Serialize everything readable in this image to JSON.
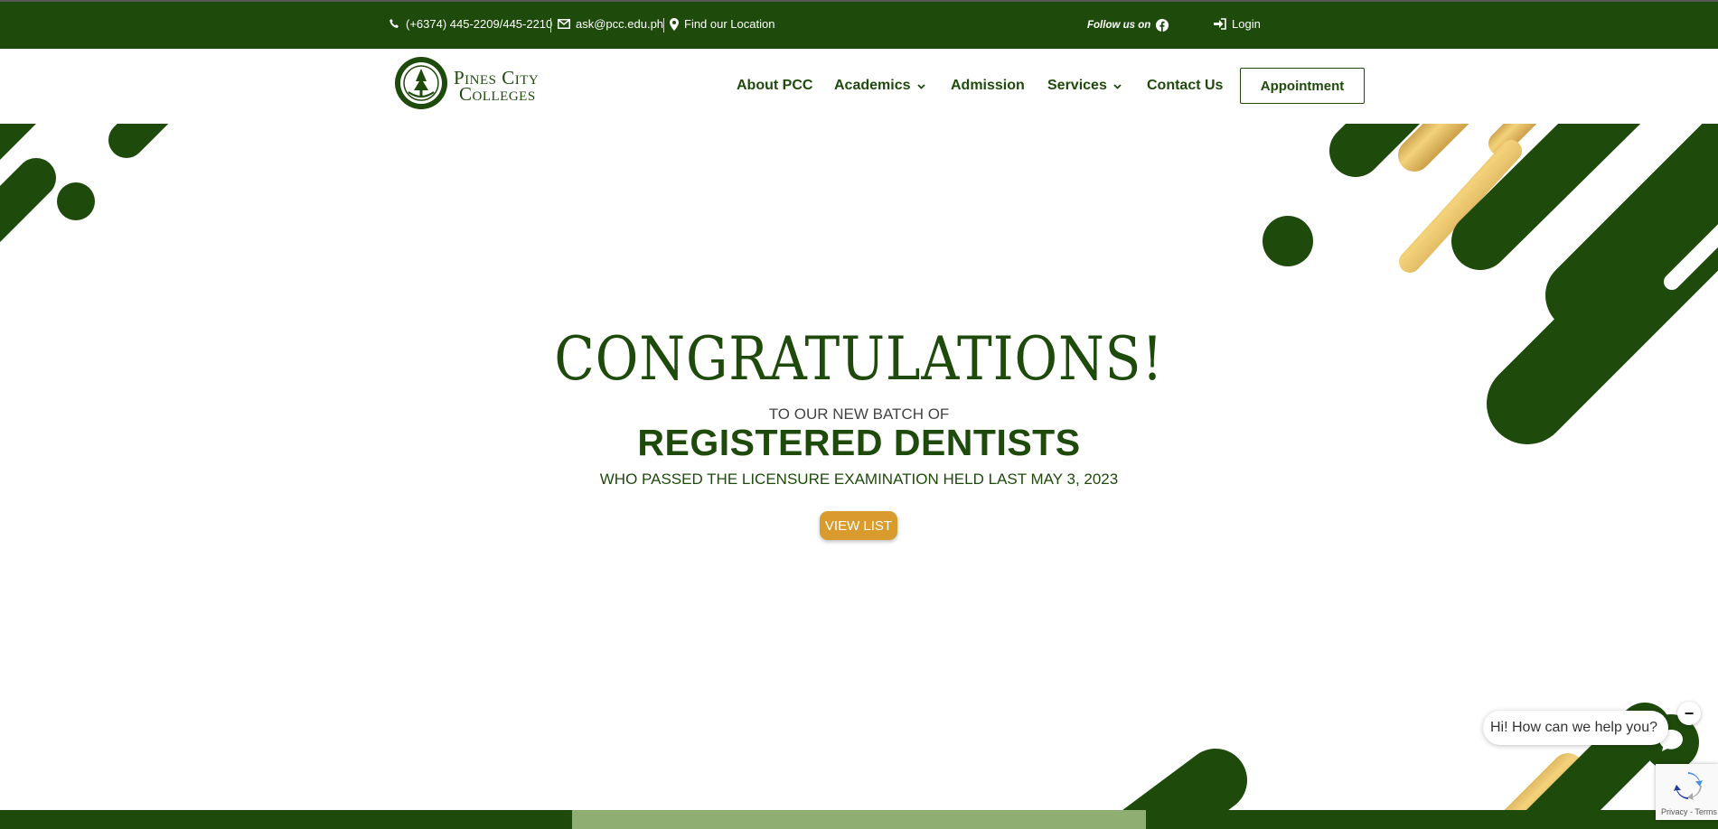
{
  "topbar": {
    "phone": "(+6374) 445-2209/445-2210",
    "email": "ask@pcc.edu.ph",
    "location": "Find our Location",
    "follow": "Follow us on",
    "login": "Login"
  },
  "logo": {
    "line1": "Pines City",
    "line2": "Colleges"
  },
  "nav": {
    "about": "About PCC",
    "academics": "Academics",
    "admission": "Admission",
    "services": "Services",
    "contact": "Contact Us",
    "appointment": "Appointment"
  },
  "hero": {
    "title": "CONGRATULATIONS!",
    "sub1": "TO OUR NEW BATCH OF",
    "main": "REGISTERED DENTISTS",
    "sub2": "WHO PASSED THE LICENSURE EXAMINATION HELD LAST MAY 3, 2023",
    "button": "VIEW LIST"
  },
  "chat": {
    "greeting": "Hi! How can we help you?",
    "minimize": "−"
  },
  "recaptcha": {
    "links": "Privacy - Terms"
  },
  "colors": {
    "brand_green": "#1e4a0c",
    "gold": "#d99a2e",
    "light_green": "#8fae72"
  },
  "icons": [
    "phone-icon",
    "envelope-icon",
    "location-pin-icon",
    "facebook-icon",
    "login-icon",
    "chevron-down-icon",
    "chat-icon",
    "recaptcha-icon"
  ]
}
